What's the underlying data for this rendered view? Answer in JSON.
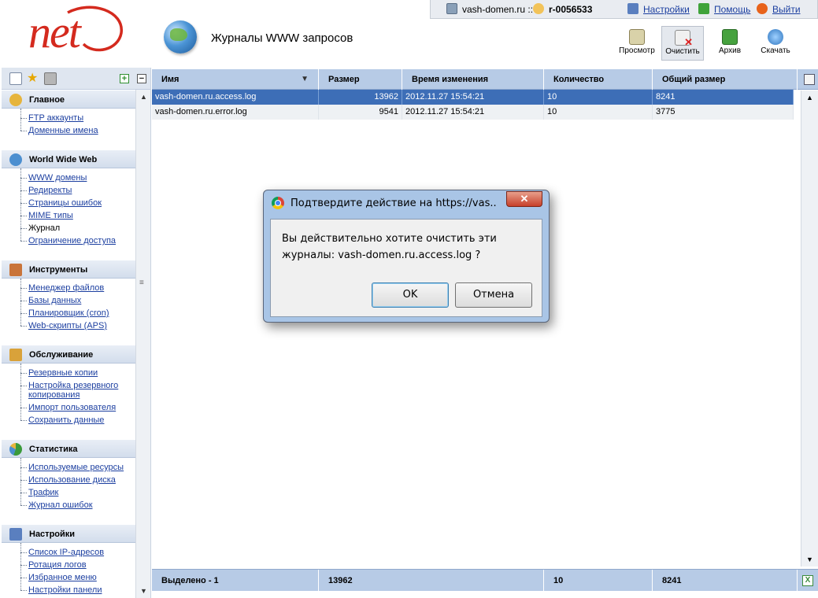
{
  "header": {
    "page_title": "Журналы WWW запросов",
    "domain": "vash-domen.ru ::",
    "user": "r-0056533",
    "links": {
      "settings": "Настройки",
      "help": "Помощь",
      "exit": "Выйти"
    }
  },
  "toolbar": {
    "view": "Просмотр",
    "clear": "Очистить",
    "archive": "Архив",
    "download": "Скачать"
  },
  "sidebar": {
    "sections": [
      {
        "title": "Главное",
        "icon": "home-icon",
        "items": [
          "FTP аккаунты",
          "Доменные имена"
        ]
      },
      {
        "title": "World Wide Web",
        "icon": "globe-icon",
        "items": [
          "WWW домены",
          "Редиректы",
          "Страницы ошибок",
          "MIME типы",
          "Журнал",
          "Ограничение доступа"
        ]
      },
      {
        "title": "Инструменты",
        "icon": "tools-icon",
        "items": [
          "Менеджер файлов",
          "Базы данных",
          "Планировщик (cron)",
          "Web-скрипты (APS)"
        ]
      },
      {
        "title": "Обслуживание",
        "icon": "maintenance-icon",
        "items": [
          "Резервные копии",
          "Настройка резервного копирования",
          "Импорт пользователя",
          "Сохранить данные"
        ]
      },
      {
        "title": "Статистика",
        "icon": "stats-icon",
        "items": [
          "Используемые ресурсы",
          "Использование диска",
          "Трафик",
          "Журнал ошибок"
        ]
      },
      {
        "title": "Настройки",
        "icon": "settings-icon",
        "items": [
          "Список IP-адресов",
          "Ротация логов",
          "Избранное меню",
          "Настройки панели"
        ]
      }
    ]
  },
  "grid": {
    "columns": [
      "Имя",
      "Размер",
      "Время изменения",
      "Количество",
      "Общий размер"
    ],
    "rows": [
      {
        "name": "vash-domen.ru.access.log",
        "size": "13962",
        "mtime": "2012.11.27 15:54:21",
        "count": "10",
        "total": "8241",
        "selected": true
      },
      {
        "name": "vash-domen.ru.error.log",
        "size": "9541",
        "mtime": "2012.11.27 15:54:21",
        "count": "10",
        "total": "3775",
        "selected": false
      }
    ],
    "footer": {
      "selected_label": "Выделено - 1",
      "size": "13962",
      "count": "10",
      "total": "8241"
    }
  },
  "dialog": {
    "title": "Подтвердите действие на https://vas...",
    "message": "Вы действительно хотите очистить эти журналы:  vash-domen.ru.access.log ?",
    "ok": "OK",
    "cancel": "Отмена"
  },
  "colors": {
    "accent": "#3d6eb7",
    "header_band": "#b7cbe6",
    "logo": "#d42a1e"
  }
}
